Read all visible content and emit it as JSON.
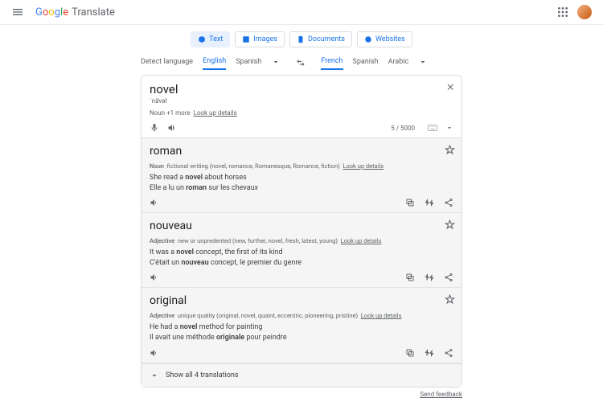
{
  "header": {
    "brand": "Google",
    "brandSub": "Translate"
  },
  "tabs": {
    "text": "Text",
    "images": "Images",
    "documents": "Documents",
    "websites": "Websites"
  },
  "langs": {
    "src": {
      "detect": "Detect language",
      "english": "English",
      "spanish": "Spanish"
    },
    "tgt": {
      "french": "French",
      "spanish": "Spanish",
      "arabic": "Arabic"
    }
  },
  "source": {
    "word": "novel",
    "pron": "ˈnävəl",
    "pos": "Noun",
    "more": "+1 more",
    "lookup": "Look up details",
    "count": "5 / 5000"
  },
  "results": [
    {
      "word": "roman",
      "pos": "Noun",
      "gloss": "fictional writing (novel, romance, Romanesque, Romance, fiction)",
      "lookup": "Look up details",
      "ex_en_pre": "She read a ",
      "ex_en_b": "novel",
      "ex_en_post": " about horses",
      "ex_tr_pre": "Elle a lu un ",
      "ex_tr_b": "roman",
      "ex_tr_post": " sur les chevaux"
    },
    {
      "word": "nouveau",
      "pos": "Adjective",
      "gloss": "new or unpredented (new, further, novel, fresh, latest, young)",
      "lookup": "Look up details",
      "ex_en_pre": "It was a ",
      "ex_en_b": "novel",
      "ex_en_post": " concept, the first of its kind",
      "ex_tr_pre": "C'était un ",
      "ex_tr_b": "nouveau",
      "ex_tr_post": " concept, le premier du genre"
    },
    {
      "word": "original",
      "pos": "Adjective",
      "gloss": "unique quality (original, novel, quaint, eccentric, pioneering, pristine)",
      "lookup": "Look up details",
      "ex_en_pre": "He had a ",
      "ex_en_b": "novel",
      "ex_en_post": " method for painting",
      "ex_tr_pre": "Il avait une méthode ",
      "ex_tr_b": "originale",
      "ex_tr_post": " pour peindre"
    }
  ],
  "showAll": "Show all 4 translations",
  "feedback": "Send feedback"
}
